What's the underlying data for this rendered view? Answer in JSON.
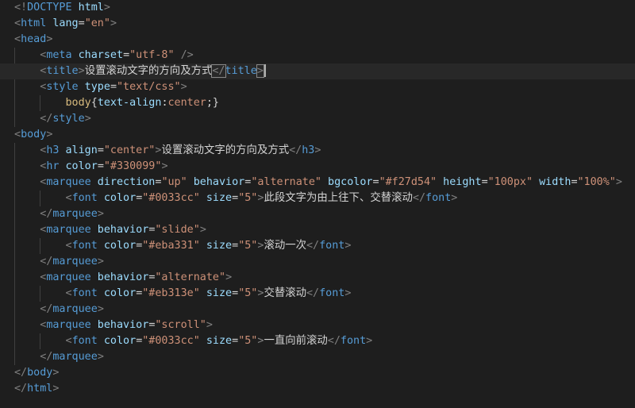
{
  "editor": {
    "language": "html",
    "lines": [
      [
        {
          "t": "<!",
          "c": "gray"
        },
        {
          "t": "DOCTYPE",
          "c": "tag"
        },
        {
          "t": " html",
          "c": "attr"
        },
        {
          "t": ">",
          "c": "gray"
        }
      ],
      [
        {
          "t": "<",
          "c": "gray"
        },
        {
          "t": "html",
          "c": "tag"
        },
        {
          "t": " lang",
          "c": "attr"
        },
        {
          "t": "=",
          "c": "text"
        },
        {
          "t": "\"en\"",
          "c": "str"
        },
        {
          "t": ">",
          "c": "gray"
        }
      ],
      [
        {
          "t": "<",
          "c": "gray"
        },
        {
          "t": "head",
          "c": "tag"
        },
        {
          "t": ">",
          "c": "gray"
        }
      ],
      [
        {
          "t": "    ",
          "c": "text"
        },
        {
          "t": "<",
          "c": "gray"
        },
        {
          "t": "meta",
          "c": "tag"
        },
        {
          "t": " charset",
          "c": "attr"
        },
        {
          "t": "=",
          "c": "text"
        },
        {
          "t": "\"utf-8\"",
          "c": "str"
        },
        {
          "t": " />",
          "c": "gray"
        }
      ],
      [
        {
          "t": "    ",
          "c": "text"
        },
        {
          "t": "<",
          "c": "gray"
        },
        {
          "t": "title",
          "c": "tag"
        },
        {
          "t": ">",
          "c": "gray"
        },
        {
          "t": "设置滚动文字的方向及方式",
          "c": "text"
        },
        {
          "t": "</",
          "c": "gray",
          "box": true
        },
        {
          "t": "title",
          "c": "tag"
        },
        {
          "t": ">",
          "c": "gray",
          "box": true
        }
      ],
      [
        {
          "t": "    ",
          "c": "text"
        },
        {
          "t": "<",
          "c": "gray"
        },
        {
          "t": "style",
          "c": "tag"
        },
        {
          "t": " type",
          "c": "attr"
        },
        {
          "t": "=",
          "c": "text"
        },
        {
          "t": "\"text/css\"",
          "c": "str"
        },
        {
          "t": ">",
          "c": "gray"
        }
      ],
      [
        {
          "t": "        ",
          "c": "text"
        },
        {
          "t": "body",
          "c": "sel"
        },
        {
          "t": "{",
          "c": "text"
        },
        {
          "t": "text-align",
          "c": "prop"
        },
        {
          "t": ":",
          "c": "text"
        },
        {
          "t": "center",
          "c": "val"
        },
        {
          "t": ";}",
          "c": "text"
        }
      ],
      [
        {
          "t": "    ",
          "c": "text"
        },
        {
          "t": "</",
          "c": "gray"
        },
        {
          "t": "style",
          "c": "tag"
        },
        {
          "t": ">",
          "c": "gray"
        }
      ],
      [
        {
          "t": "<",
          "c": "gray"
        },
        {
          "t": "body",
          "c": "tag"
        },
        {
          "t": ">",
          "c": "gray"
        }
      ],
      [
        {
          "t": "    ",
          "c": "text"
        },
        {
          "t": "<",
          "c": "gray"
        },
        {
          "t": "h3",
          "c": "tag"
        },
        {
          "t": " align",
          "c": "attr"
        },
        {
          "t": "=",
          "c": "text"
        },
        {
          "t": "\"center\"",
          "c": "str"
        },
        {
          "t": ">",
          "c": "gray"
        },
        {
          "t": "设置滚动文字的方向及方式",
          "c": "text"
        },
        {
          "t": "</",
          "c": "gray"
        },
        {
          "t": "h3",
          "c": "tag"
        },
        {
          "t": ">",
          "c": "gray"
        }
      ],
      [
        {
          "t": "    ",
          "c": "text"
        },
        {
          "t": "<",
          "c": "gray"
        },
        {
          "t": "hr",
          "c": "tag"
        },
        {
          "t": " color",
          "c": "attr"
        },
        {
          "t": "=",
          "c": "text"
        },
        {
          "t": "\"#330099\"",
          "c": "str"
        },
        {
          "t": ">",
          "c": "gray"
        }
      ],
      [
        {
          "t": "    ",
          "c": "text"
        },
        {
          "t": "<",
          "c": "gray"
        },
        {
          "t": "marquee",
          "c": "tag"
        },
        {
          "t": " direction",
          "c": "attr"
        },
        {
          "t": "=",
          "c": "text"
        },
        {
          "t": "\"up\"",
          "c": "str"
        },
        {
          "t": " behavior",
          "c": "attr"
        },
        {
          "t": "=",
          "c": "text"
        },
        {
          "t": "\"alternate\"",
          "c": "str"
        },
        {
          "t": " bgcolor",
          "c": "attr"
        },
        {
          "t": "=",
          "c": "text"
        },
        {
          "t": "\"#f27d54\"",
          "c": "str"
        },
        {
          "t": " height",
          "c": "attr"
        },
        {
          "t": "=",
          "c": "text"
        },
        {
          "t": "\"100px\"",
          "c": "str"
        },
        {
          "t": " width",
          "c": "attr"
        },
        {
          "t": "=",
          "c": "text"
        },
        {
          "t": "\"100%\"",
          "c": "str"
        },
        {
          "t": ">",
          "c": "gray"
        }
      ],
      [
        {
          "t": "        ",
          "c": "text"
        },
        {
          "t": "<",
          "c": "gray"
        },
        {
          "t": "font",
          "c": "tag"
        },
        {
          "t": " color",
          "c": "attr"
        },
        {
          "t": "=",
          "c": "text"
        },
        {
          "t": "\"#0033cc\"",
          "c": "str"
        },
        {
          "t": " size",
          "c": "attr"
        },
        {
          "t": "=",
          "c": "text"
        },
        {
          "t": "\"5\"",
          "c": "str"
        },
        {
          "t": ">",
          "c": "gray"
        },
        {
          "t": "此段文字为由上往下、交替滚动",
          "c": "text"
        },
        {
          "t": "</",
          "c": "gray"
        },
        {
          "t": "font",
          "c": "tag"
        },
        {
          "t": ">",
          "c": "gray"
        }
      ],
      [
        {
          "t": "    ",
          "c": "text"
        },
        {
          "t": "</",
          "c": "gray"
        },
        {
          "t": "marquee",
          "c": "tag"
        },
        {
          "t": ">",
          "c": "gray"
        }
      ],
      [
        {
          "t": "    ",
          "c": "text"
        },
        {
          "t": "<",
          "c": "gray"
        },
        {
          "t": "marquee",
          "c": "tag"
        },
        {
          "t": " behavior",
          "c": "attr"
        },
        {
          "t": "=",
          "c": "text"
        },
        {
          "t": "\"slide\"",
          "c": "str"
        },
        {
          "t": ">",
          "c": "gray"
        }
      ],
      [
        {
          "t": "        ",
          "c": "text"
        },
        {
          "t": "<",
          "c": "gray"
        },
        {
          "t": "font",
          "c": "tag"
        },
        {
          "t": " color",
          "c": "attr"
        },
        {
          "t": "=",
          "c": "text"
        },
        {
          "t": "\"#eba331\"",
          "c": "str"
        },
        {
          "t": " size",
          "c": "attr"
        },
        {
          "t": "=",
          "c": "text"
        },
        {
          "t": "\"5\"",
          "c": "str"
        },
        {
          "t": ">",
          "c": "gray"
        },
        {
          "t": "滚动一次",
          "c": "text"
        },
        {
          "t": "</",
          "c": "gray"
        },
        {
          "t": "font",
          "c": "tag"
        },
        {
          "t": ">",
          "c": "gray"
        }
      ],
      [
        {
          "t": "    ",
          "c": "text"
        },
        {
          "t": "</",
          "c": "gray"
        },
        {
          "t": "marquee",
          "c": "tag"
        },
        {
          "t": ">",
          "c": "gray"
        }
      ],
      [
        {
          "t": "    ",
          "c": "text"
        },
        {
          "t": "<",
          "c": "gray"
        },
        {
          "t": "marquee",
          "c": "tag"
        },
        {
          "t": " behavior",
          "c": "attr"
        },
        {
          "t": "=",
          "c": "text"
        },
        {
          "t": "\"alternate\"",
          "c": "str"
        },
        {
          "t": ">",
          "c": "gray"
        }
      ],
      [
        {
          "t": "        ",
          "c": "text"
        },
        {
          "t": "<",
          "c": "gray"
        },
        {
          "t": "font",
          "c": "tag"
        },
        {
          "t": " color",
          "c": "attr"
        },
        {
          "t": "=",
          "c": "text"
        },
        {
          "t": "\"#eb313e\"",
          "c": "str"
        },
        {
          "t": " size",
          "c": "attr"
        },
        {
          "t": "=",
          "c": "text"
        },
        {
          "t": "\"5\"",
          "c": "str"
        },
        {
          "t": ">",
          "c": "gray"
        },
        {
          "t": "交替滚动",
          "c": "text"
        },
        {
          "t": "</",
          "c": "gray"
        },
        {
          "t": "font",
          "c": "tag"
        },
        {
          "t": ">",
          "c": "gray"
        }
      ],
      [
        {
          "t": "    ",
          "c": "text"
        },
        {
          "t": "</",
          "c": "gray"
        },
        {
          "t": "marquee",
          "c": "tag"
        },
        {
          "t": ">",
          "c": "gray"
        }
      ],
      [
        {
          "t": "    ",
          "c": "text"
        },
        {
          "t": "<",
          "c": "gray"
        },
        {
          "t": "marquee",
          "c": "tag"
        },
        {
          "t": " behavior",
          "c": "attr"
        },
        {
          "t": "=",
          "c": "text"
        },
        {
          "t": "\"scroll\"",
          "c": "str"
        },
        {
          "t": ">",
          "c": "gray"
        }
      ],
      [
        {
          "t": "        ",
          "c": "text"
        },
        {
          "t": "<",
          "c": "gray"
        },
        {
          "t": "font",
          "c": "tag"
        },
        {
          "t": " color",
          "c": "attr"
        },
        {
          "t": "=",
          "c": "text"
        },
        {
          "t": "\"#0033cc\"",
          "c": "str"
        },
        {
          "t": " size",
          "c": "attr"
        },
        {
          "t": "=",
          "c": "text"
        },
        {
          "t": "\"5\"",
          "c": "str"
        },
        {
          "t": ">",
          "c": "gray"
        },
        {
          "t": "一直向前滚动",
          "c": "text"
        },
        {
          "t": "</",
          "c": "gray"
        },
        {
          "t": "font",
          "c": "tag"
        },
        {
          "t": ">",
          "c": "gray"
        }
      ],
      [
        {
          "t": "    ",
          "c": "text"
        },
        {
          "t": "</",
          "c": "gray"
        },
        {
          "t": "marquee",
          "c": "tag"
        },
        {
          "t": ">",
          "c": "gray"
        }
      ],
      [
        {
          "t": "</",
          "c": "gray"
        },
        {
          "t": "body",
          "c": "tag"
        },
        {
          "t": ">",
          "c": "gray"
        }
      ],
      [
        {
          "t": "</",
          "c": "gray"
        },
        {
          "t": "html",
          "c": "tag"
        },
        {
          "t": ">",
          "c": "gray"
        }
      ]
    ],
    "current_line": 4,
    "colors": {
      "background": "#1e1e1e",
      "current_line": "#282828",
      "gray": "#808080",
      "tag": "#569cd6",
      "attr": "#9cdcfe",
      "str": "#ce9178",
      "text": "#d4d4d4",
      "sel": "#d7ba7d",
      "prop": "#9cdcfe",
      "val": "#ce9178"
    }
  }
}
